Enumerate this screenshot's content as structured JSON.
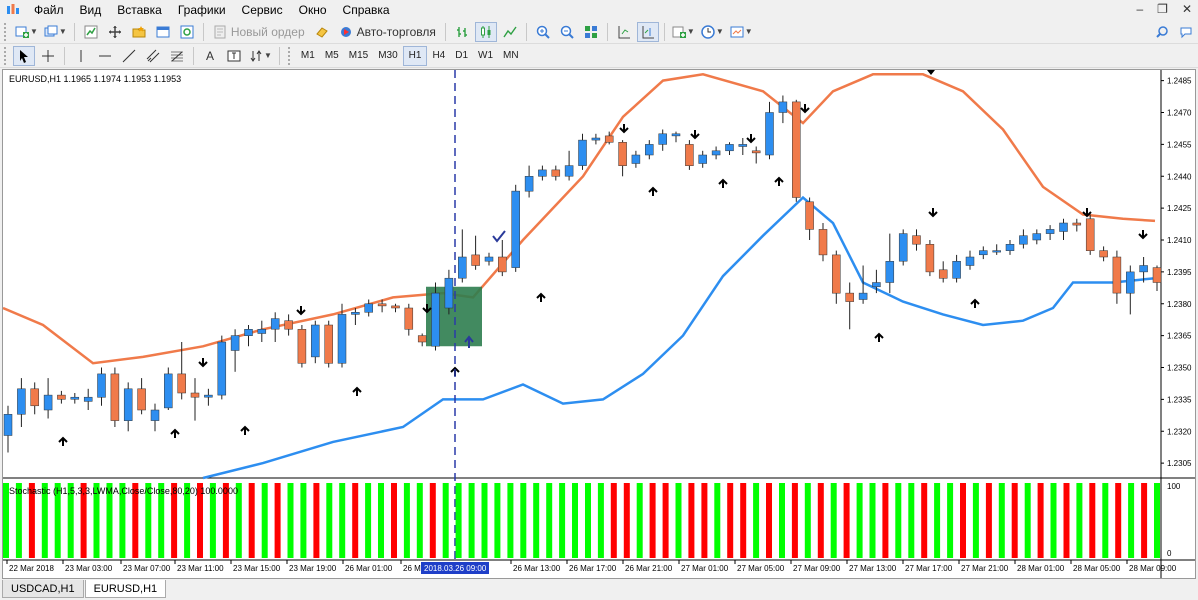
{
  "menu": [
    "Файл",
    "Вид",
    "Вставка",
    "Графики",
    "Сервис",
    "Окно",
    "Справка"
  ],
  "toolbar": {
    "new_order": "Новый ордер",
    "auto_trading": "Авто-торговля"
  },
  "tools": {
    "text_tool": "A",
    "timeframes": [
      "M1",
      "M5",
      "M15",
      "M30",
      "H1",
      "H4",
      "D1",
      "W1",
      "MN"
    ],
    "active_timeframe": "H1"
  },
  "chart": {
    "symbol_info": "EURUSD,H1  1.1965 1.1974 1.1953 1.1953",
    "indicator_label": "Stochastic (H1,5,3,3,LWMA,Close/Close,80,20) 100.0000",
    "crosshair_time": "2018.03.26 09:00",
    "bullish_color": "#2d8ef0",
    "bearish_color": "#f07a4a",
    "upper_band_color": "#f07a4a",
    "lower_band_color": "#2d8ef0",
    "histogram_up_color": "#00ff00",
    "histogram_down_color": "#ff0000",
    "highlight_color": "#2e7d4f"
  },
  "chart_data": {
    "type": "candlestick",
    "price_axis": [
      "1.2485",
      "1.2470",
      "1.2455",
      "1.2440",
      "1.2425",
      "1.2410",
      "1.2395",
      "1.2380",
      "1.2365",
      "1.2350",
      "1.2335",
      "1.2320",
      "1.2305"
    ],
    "time_axis": [
      "22 Mar 2018",
      "23 Mar 03:00",
      "23 Mar 07:00",
      "23 Mar 11:00",
      "23 Mar 15:00",
      "23 Mar 19:00",
      "26 Mar 01:00",
      "26 Mar 05:00",
      "26 Mar 13:00",
      "26 Mar 17:00",
      "26 Mar 21:00",
      "27 Mar 01:00",
      "27 Mar 05:00",
      "27 Mar 09:00",
      "27 Mar 13:00",
      "27 Mar 17:00",
      "27 Mar 21:00",
      "28 Mar 01:00",
      "28 Mar 05:00",
      "28 Mar 09:00"
    ],
    "stoch_axis": [
      "100",
      "0"
    ],
    "ylim": [
      1.2298,
      1.249
    ]
  },
  "tabs": [
    "USDCAD,H1",
    "EURUSD,H1"
  ],
  "active_tab": "EURUSD,H1"
}
